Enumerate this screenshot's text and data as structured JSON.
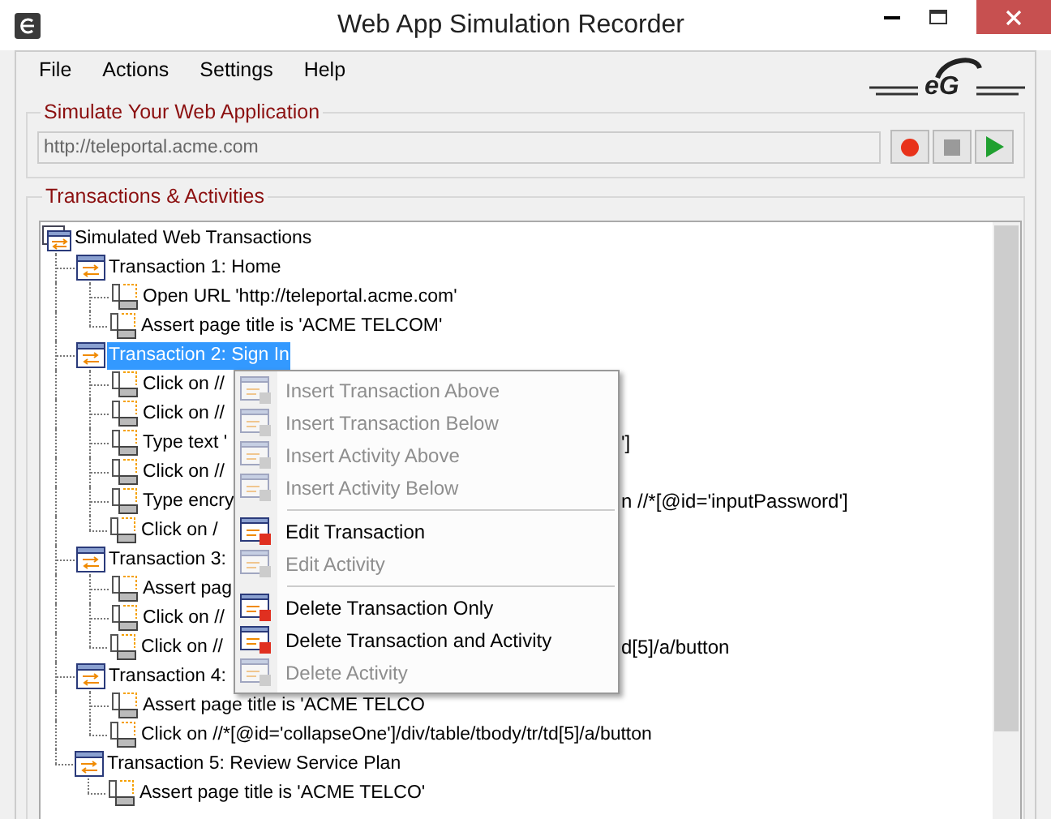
{
  "window": {
    "title": "Web App Simulation Recorder"
  },
  "menu_bar": [
    "File",
    "Actions",
    "Settings",
    "Help"
  ],
  "logo": "eG",
  "simulate_group": {
    "title": "Simulate Your Web Application",
    "url": "http://teleportal.acme.com"
  },
  "tree_group": {
    "title": "Transactions & Activities"
  },
  "tree": {
    "label": "Simulated Web Transactions",
    "selected": false,
    "children": [
      {
        "label": "Transaction 1: Home",
        "selected": false,
        "children": [
          {
            "label": "Open URL 'http://teleportal.acme.com'",
            "selected": false
          },
          {
            "label": "Assert page title is 'ACME TELCOM'",
            "selected": false
          }
        ]
      },
      {
        "label": "Transaction 2: Sign In",
        "selected": true,
        "children": [
          {
            "label": "Click on //",
            "selected": false
          },
          {
            "label": "Click on //",
            "selected": false
          },
          {
            "label": "Type text '",
            "tail": "']",
            "selected": false
          },
          {
            "label": "Click on //",
            "selected": false
          },
          {
            "label": "Type encry",
            "tail": "n //*[@id='inputPassword']",
            "selected": false
          },
          {
            "label": "Click on /",
            "selected": false
          }
        ]
      },
      {
        "label": "Transaction 3:",
        "selected": false,
        "children": [
          {
            "label": "Assert pag",
            "selected": false
          },
          {
            "label": "Click on //",
            "selected": false
          },
          {
            "label": "Click on //",
            "tail": "d[5]/a/button",
            "selected": false
          }
        ]
      },
      {
        "label": "Transaction 4:",
        "selected": false,
        "children": [
          {
            "label": "Assert page title is 'ACME TELCO",
            "selected": false
          },
          {
            "label": "Click on //*[@id='collapseOne']/div/table/tbody/tr/td[5]/a/button",
            "selected": false
          }
        ]
      },
      {
        "label": "Transaction 5: Review Service Plan",
        "selected": false,
        "children": [
          {
            "label": "Assert page title is 'ACME TELCO'",
            "selected": false
          }
        ]
      }
    ]
  },
  "context_menu": [
    {
      "kind": "item",
      "label": "Insert Transaction Above",
      "disabled": true
    },
    {
      "kind": "item",
      "label": "Insert Transaction Below",
      "disabled": true
    },
    {
      "kind": "item",
      "label": "Insert Activity Above",
      "disabled": true
    },
    {
      "kind": "item",
      "label": "Insert Activity Below",
      "disabled": true
    },
    {
      "kind": "separator"
    },
    {
      "kind": "item",
      "label": "Edit Transaction",
      "disabled": false
    },
    {
      "kind": "item",
      "label": "Edit Activity",
      "disabled": true
    },
    {
      "kind": "separator"
    },
    {
      "kind": "item",
      "label": "Delete Transaction Only",
      "disabled": false
    },
    {
      "kind": "item",
      "label": "Delete Transaction and Activity",
      "disabled": false
    },
    {
      "kind": "item",
      "label": "Delete Activity",
      "disabled": true
    }
  ]
}
